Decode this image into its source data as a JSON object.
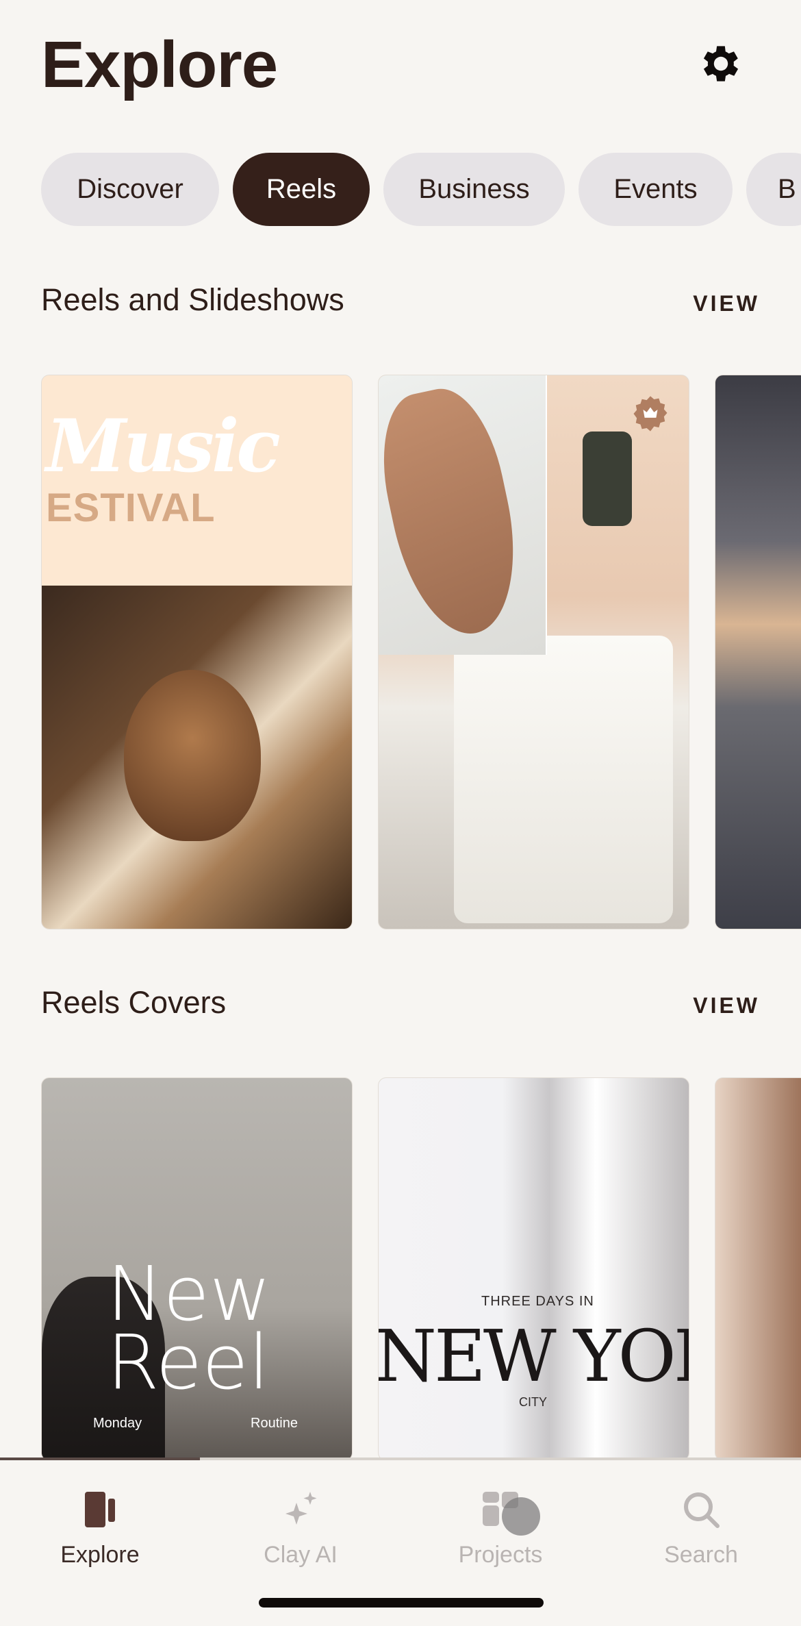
{
  "header": {
    "title": "Explore",
    "settings_icon": "gear-icon"
  },
  "chips": [
    {
      "label": "Discover",
      "active": false
    },
    {
      "label": "Reels",
      "active": true
    },
    {
      "label": "Business",
      "active": false
    },
    {
      "label": "Events",
      "active": false
    },
    {
      "label": "B",
      "active": false
    }
  ],
  "sections": [
    {
      "title": "Reels and Slideshows",
      "view_label": "VIEW",
      "cards": [
        {
          "text_1": "Music",
          "text_2": "ESTIVAL"
        },
        {
          "badge_icon": "crown-icon"
        },
        {}
      ]
    },
    {
      "title": "Reels Covers",
      "view_label": "VIEW",
      "cards": [
        {
          "line_1": "New",
          "line_2": "Reel",
          "left_caption": "Monday",
          "right_caption": "Routine"
        },
        {
          "kicker": "THREE DAYS IN",
          "headline": "NEW YORK",
          "caption": "CITY"
        },
        {}
      ]
    }
  ],
  "nav": {
    "items": [
      {
        "label": "Explore",
        "icon": "explore-icon",
        "active": true
      },
      {
        "label": "Clay AI",
        "icon": "sparkle-icon",
        "active": false
      },
      {
        "label": "Projects",
        "icon": "projects-icon",
        "active": false
      },
      {
        "label": "Search",
        "icon": "search-icon",
        "active": false
      }
    ]
  },
  "colors": {
    "background": "#f7f5f2",
    "primary": "#35201a",
    "chip": "#e6e3e6",
    "inactive_nav": "#b9b4b2"
  }
}
